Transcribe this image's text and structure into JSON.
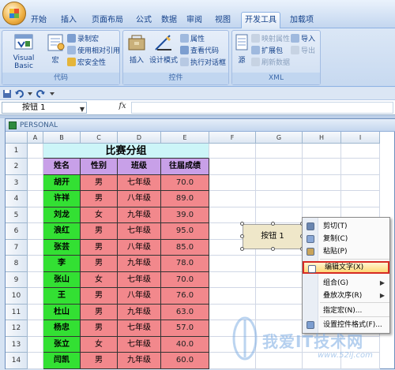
{
  "ribbon_tabs": [
    "开始",
    "插入",
    "页面布局",
    "公式",
    "数据",
    "审阅",
    "视图",
    "开发工具",
    "加载项"
  ],
  "ribbon": {
    "code_group": {
      "label": "代码",
      "visual_basic": "Visual Basic",
      "macro": "宏",
      "record_macro": "录制宏",
      "relative_refs": "使用相对引用",
      "macro_security": "宏安全性"
    },
    "controls_group": {
      "label": "控件",
      "insert": "插入",
      "design_mode": "设计模式",
      "properties": "属性",
      "view_code": "查看代码",
      "run_dialog": "执行对话框"
    },
    "xml_group": {
      "label": "XML",
      "source": "源",
      "map_properties": "映射属性",
      "expansion_packs": "扩展包",
      "refresh_data": "刷新数据",
      "import": "导入",
      "export": "导出"
    }
  },
  "name_box": "按钮 1",
  "fx_label": "fx",
  "workbook_title": "PERSONAL",
  "columns": [
    "A",
    "B",
    "C",
    "D",
    "E",
    "F",
    "G",
    "H",
    "I"
  ],
  "rows": [
    "1",
    "2",
    "3",
    "4",
    "5",
    "6",
    "7",
    "8",
    "9",
    "10",
    "11",
    "12",
    "13",
    "14"
  ],
  "table": {
    "title": "比赛分组",
    "headers": [
      "姓名",
      "性别",
      "班级",
      "往届成绩"
    ],
    "data": [
      [
        "胡开",
        "男",
        "七年级",
        "70.0"
      ],
      [
        "许祥",
        "男",
        "八年级",
        "89.0"
      ],
      [
        "刘龙",
        "女",
        "九年级",
        "39.0"
      ],
      [
        "浪红",
        "男",
        "七年级",
        "95.0"
      ],
      [
        "张芸",
        "男",
        "八年级",
        "85.0"
      ],
      [
        "李",
        "男",
        "九年级",
        "78.0"
      ],
      [
        "张山",
        "女",
        "七年级",
        "70.0"
      ],
      [
        "王",
        "男",
        "八年级",
        "76.0"
      ],
      [
        "杜山",
        "男",
        "九年级",
        "63.0"
      ],
      [
        "杨忠",
        "男",
        "七年级",
        "57.0"
      ],
      [
        "张立",
        "女",
        "七年级",
        "40.0"
      ],
      [
        "闫凯",
        "男",
        "九年级",
        "60.0"
      ]
    ]
  },
  "form_button_label": "按钮 1",
  "context_menu": [
    {
      "label": "剪切(T)",
      "icon": "scissors-icon",
      "submenu": false
    },
    {
      "label": "复制(C)",
      "icon": "copy-icon",
      "submenu": false
    },
    {
      "label": "粘贴(P)",
      "icon": "paste-icon",
      "submenu": false
    },
    {
      "label": "编辑文字(X)",
      "icon": "edit-text-icon",
      "submenu": false,
      "highlighted": true
    },
    {
      "label": "组合(G)",
      "icon": "",
      "submenu": true
    },
    {
      "label": "叠放次序(R)",
      "icon": "",
      "submenu": true
    },
    {
      "label": "指定宏(N)...",
      "icon": "",
      "submenu": false
    },
    {
      "label": "设置控件格式(F)...",
      "icon": "format-icon",
      "submenu": false
    }
  ],
  "watermark": {
    "text": "我爱IT技术网",
    "url": "www.52ij.com"
  },
  "colors": {
    "header_purple": "#c8a0e8",
    "name_green": "#33e033",
    "cell_red": "#f2888c",
    "title_cyan": "#ccf5f8",
    "highlight_border": "#d62a24"
  }
}
